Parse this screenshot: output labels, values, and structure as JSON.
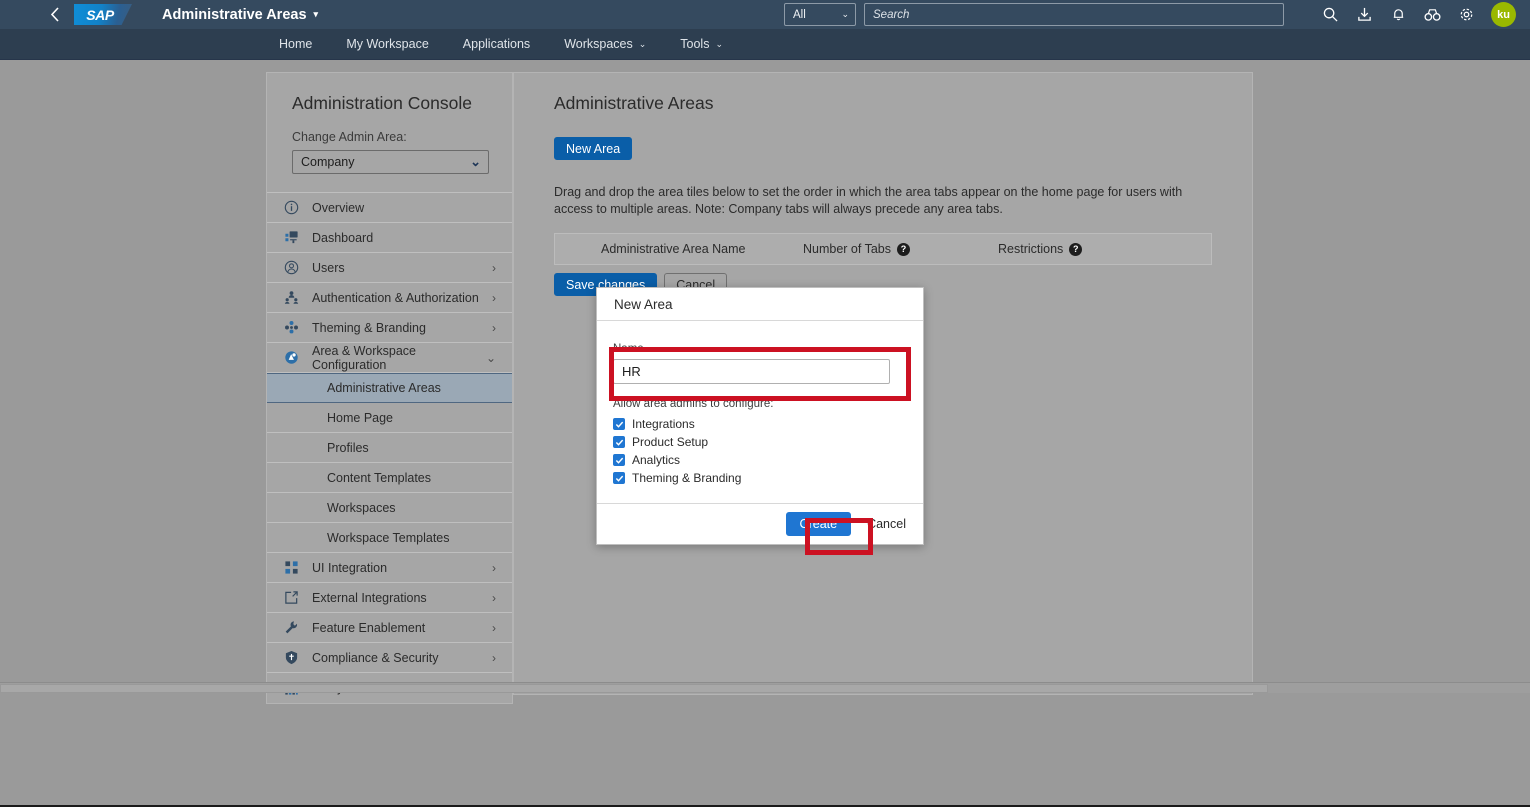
{
  "header": {
    "back_icon": "chevron-left-icon",
    "logo_text": "SAP",
    "app_title": "Administrative Areas",
    "app_title_caret": "▾",
    "search_scope": "All",
    "search_scope_caret": "⌄",
    "search_placeholder": "Search",
    "search_value": "",
    "icons": [
      "search-icon",
      "download-icon",
      "notifications-bell-icon",
      "binoculars-icon",
      "settings-gear-icon"
    ],
    "avatar_initials": "ku",
    "bar_color": "#354a5f",
    "avatar_color": "#9ab800"
  },
  "nav": {
    "items": [
      {
        "label": "Home",
        "has_caret": false
      },
      {
        "label": "My Workspace",
        "has_caret": false
      },
      {
        "label": "Applications",
        "has_caret": false
      },
      {
        "label": "Workspaces",
        "has_caret": true
      },
      {
        "label": "Tools",
        "has_caret": true
      }
    ],
    "caret": "⌄",
    "bar_color": "#2d3e50"
  },
  "sidebar": {
    "title": "Administration Console",
    "change_area_label": "Change Admin Area:",
    "change_area_value": "Company",
    "change_area_caret": "⌄",
    "items": [
      {
        "label": "Overview",
        "icon": "info-circle-icon",
        "arrow": "",
        "level": "top"
      },
      {
        "label": "Dashboard",
        "icon": "dashboard-icon",
        "arrow": "",
        "level": "top"
      },
      {
        "label": "Users",
        "icon": "user-circle-icon",
        "arrow": "›",
        "level": "top"
      },
      {
        "label": "Authentication & Authorization",
        "icon": "key-people-icon",
        "arrow": "›",
        "level": "top"
      },
      {
        "label": "Theming & Branding",
        "icon": "palette-dots-icon",
        "arrow": "›",
        "level": "top"
      },
      {
        "label": "Area & Workspace Configuration",
        "icon": "area-config-icon",
        "arrow": "⌄",
        "level": "top"
      },
      {
        "label": "Administrative Areas",
        "icon": "",
        "arrow": "",
        "level": "sub",
        "active": true
      },
      {
        "label": "Home Page",
        "icon": "",
        "arrow": "",
        "level": "sub"
      },
      {
        "label": "Profiles",
        "icon": "",
        "arrow": "",
        "level": "sub"
      },
      {
        "label": "Content Templates",
        "icon": "",
        "arrow": "",
        "level": "sub"
      },
      {
        "label": "Workspaces",
        "icon": "",
        "arrow": "",
        "level": "sub"
      },
      {
        "label": "Workspace Templates",
        "icon": "",
        "arrow": "",
        "level": "sub"
      },
      {
        "label": "UI Integration",
        "icon": "ui-integration-icon",
        "arrow": "›",
        "level": "top"
      },
      {
        "label": "External Integrations",
        "icon": "external-link-icon",
        "arrow": "›",
        "level": "top"
      },
      {
        "label": "Feature Enablement",
        "icon": "wrench-icon",
        "arrow": "›",
        "level": "top"
      },
      {
        "label": "Compliance & Security",
        "icon": "shield-icon",
        "arrow": "›",
        "level": "top"
      },
      {
        "label": "Analytics",
        "icon": "bar-chart-icon",
        "arrow": "›",
        "level": "top"
      }
    ]
  },
  "main": {
    "title": "Administrative Areas",
    "new_area_label": "New Area",
    "helper_text": "Drag and drop the area tiles below to set the order in which the area tabs appear on the home page for users with access to multiple areas. Note: Company tabs will always precede any area tabs.",
    "table": {
      "columns": [
        {
          "label": "Administrative Area Name",
          "help": false
        },
        {
          "label": "Number of Tabs",
          "help": true
        },
        {
          "label": "Restrictions",
          "help": true
        }
      ],
      "help_glyph": "?",
      "rows": []
    },
    "save_label": "Save changes",
    "cancel_label": "Cancel"
  },
  "modal": {
    "title": "New Area",
    "name_label": "Name",
    "name_value": "HR",
    "configure_label": "Allow area admins to configure:",
    "checkboxes": [
      {
        "label": "Integrations",
        "checked": true
      },
      {
        "label": "Product Setup",
        "checked": true
      },
      {
        "label": "Analytics",
        "checked": true
      },
      {
        "label": "Theming & Branding",
        "checked": true
      }
    ],
    "create_label": "Create",
    "cancel_label": "Cancel",
    "accent_color": "#1f76d2"
  },
  "annotations": {
    "highlight_color": "#cc1122",
    "boxes": [
      "name-field-highlight",
      "create-button-highlight"
    ]
  }
}
